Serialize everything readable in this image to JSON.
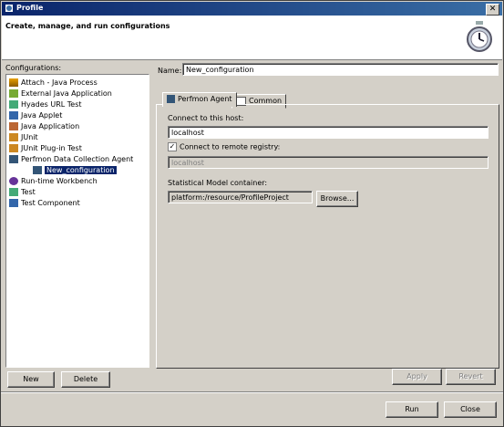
{
  "window": {
    "title": "Profile",
    "close_glyph": "✕"
  },
  "banner": {
    "heading": "Create, manage, and run configurations"
  },
  "configurations": {
    "label": "Configurations:",
    "items": [
      {
        "label": "Attach - Java Process",
        "icon": "attach-icon"
      },
      {
        "label": "External Java Application",
        "icon": "external-app-icon"
      },
      {
        "label": "Hyades URL Test",
        "icon": "url-test-icon"
      },
      {
        "label": "Java Applet",
        "icon": "applet-icon"
      },
      {
        "label": "Java Application",
        "icon": "java-app-icon"
      },
      {
        "label": "JUnit",
        "icon": "junit-icon"
      },
      {
        "label": "JUnit Plug-in Test",
        "icon": "junit-plugin-icon"
      },
      {
        "label": "Perfmon Data Collection Agent",
        "icon": "perfmon-icon"
      },
      {
        "label": "New_configuration",
        "icon": "perfmon-config-icon",
        "selected": true
      },
      {
        "label": "Run-time Workbench",
        "icon": "workbench-icon"
      },
      {
        "label": "Test",
        "icon": "test-icon"
      },
      {
        "label": "Test Component",
        "icon": "test-component-icon"
      }
    ],
    "new_label": "New",
    "delete_label": "Delete"
  },
  "name_field": {
    "label": "Name:",
    "value": "New_configuration"
  },
  "tabs": [
    {
      "label": "Perfmon Agent",
      "active": true
    },
    {
      "label": "Common",
      "active": false
    }
  ],
  "perfmon": {
    "host_label": "Connect to this host:",
    "host_value": "localhost",
    "registry_label": "Connect to remote registry:",
    "registry_checked": true,
    "registry_value": "localhost",
    "container_label": "Statistical Model container:",
    "container_value": "platform:/resource/ProfileProject",
    "browse_label": "Browse..."
  },
  "actions": {
    "apply": "Apply",
    "revert": "Revert",
    "run": "Run",
    "close": "Close"
  },
  "colors": {
    "titlebar": "#0a246a",
    "selection": "#0a246a",
    "face": "#d4d0c8"
  }
}
